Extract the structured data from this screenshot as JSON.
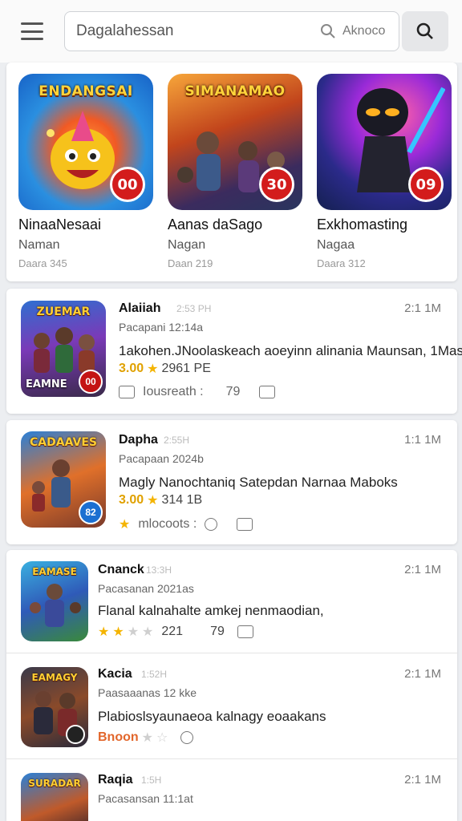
{
  "header": {
    "search_value": "Dagalahessan",
    "search_hint": "Aknoco"
  },
  "featured": [
    {
      "art_title": "ENDANGSAI",
      "badge": "00",
      "name": "NinaaNesaai",
      "sub": "Naman",
      "meta": "Daara 345"
    },
    {
      "art_title": "SIMANAMAO",
      "badge": "30",
      "name": "Aanas daSago",
      "sub": "Nagan",
      "meta": "Daan 219"
    },
    {
      "art_title": "",
      "badge": "09",
      "name": "Exkhomasting",
      "sub": "Nagaa",
      "meta": "Daara 312"
    }
  ],
  "list": [
    {
      "thumb_title": "ZUEMAR",
      "thumb_foot": "EAMNE",
      "badge": "00",
      "name": "Alaiiah",
      "time": "2:53 PH",
      "right": "2:1 1M",
      "publisher": "Pacapani 12:14a",
      "desc": "1akohen.JNoolaskeach aoeyinn alinania Maunsan, 1Mas",
      "rating_label": "3.00",
      "rating_text": "2961 PE",
      "actions": {
        "label": "Iousreath :",
        "count": "79"
      }
    },
    {
      "thumb_title": "CADAAVES",
      "thumb_foot": "",
      "badge": "82",
      "name": "Dapha",
      "time": "2:55H",
      "right": "1:1 1M",
      "publisher": "Pacapaan 2024b",
      "desc": "Magly Nanochtaniq Satepdan Narnaa Maboks",
      "rating_label": "3.00",
      "rating_text": "314 1B",
      "actions": {
        "label": "mlocoots :",
        "count": ""
      }
    },
    {
      "thumb_title": "EAMASE",
      "thumb_foot": "",
      "badge": "",
      "name": "Cnanck",
      "time": "13:3H",
      "right": "2:1 1M",
      "publisher": "Pacasanan 2021as",
      "desc": "Flanal kalnahalte amkej nenmaodian,",
      "rating_label": "",
      "rating_text": "221",
      "actions": {
        "label": "",
        "count": "79"
      }
    },
    {
      "thumb_title": "EAMAGY",
      "thumb_foot": "",
      "badge": "",
      "name": "Kacia",
      "time": "1:52H",
      "right": "2:1 1M",
      "publisher": "Paasaaanas 12 kke",
      "desc": "Plabioslsyaunaeoa kalnagy eoaakans",
      "rating_label": "Bnoon",
      "rating_text": "",
      "actions": {
        "label": "",
        "count": ""
      }
    },
    {
      "thumb_title": "SURADAR",
      "thumb_foot": "",
      "badge": "",
      "name": "Raqia",
      "time": "1:5H",
      "right": "2:1 1M",
      "publisher": "Pacasansan 11:1at",
      "desc": "",
      "rating_label": "",
      "rating_text": "",
      "actions": {
        "label": "",
        "count": ""
      }
    }
  ],
  "colors": {
    "accent_red": "#d31c1c",
    "star_gold": "#f4b400",
    "page_bg": "#eceef1"
  }
}
